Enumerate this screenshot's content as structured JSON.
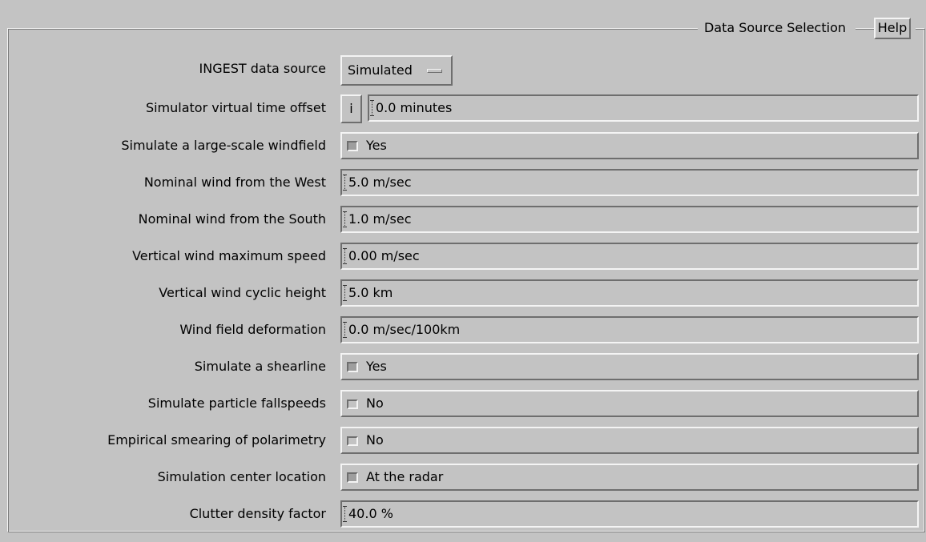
{
  "title": "Data Source Selection",
  "help_label": "Help",
  "ingest": {
    "label": "INGEST data source",
    "value": "Simulated"
  },
  "time_offset": {
    "label": "Simulator virtual time offset",
    "info_label": "i",
    "value": "0.0 minutes"
  },
  "rows": [
    {
      "label": "Simulate a large-scale windfield",
      "type": "toggle",
      "checked": true,
      "value": "Yes"
    },
    {
      "label": "Nominal wind from the West",
      "type": "field",
      "value": "5.0 m/sec"
    },
    {
      "label": "Nominal wind from the South",
      "type": "field",
      "value": "1.0 m/sec"
    },
    {
      "label": "Vertical wind maximum speed",
      "type": "field",
      "value": "0.00 m/sec"
    },
    {
      "label": "Vertical wind cyclic height",
      "type": "field",
      "value": "5.0 km"
    },
    {
      "label": "Wind field deformation",
      "type": "field",
      "value": "0.0 m/sec/100km"
    },
    {
      "label": "Simulate a shearline",
      "type": "toggle",
      "checked": true,
      "value": "Yes"
    },
    {
      "label": "Simulate particle fallspeeds",
      "type": "toggle",
      "checked": false,
      "value": "No"
    },
    {
      "label": "Empirical smearing of polarimetry",
      "type": "toggle",
      "checked": false,
      "value": "No"
    },
    {
      "label": "Simulation center location",
      "type": "toggle",
      "checked": true,
      "value": "At the radar"
    },
    {
      "label": "Clutter density factor",
      "type": "field",
      "value": "40.0 %"
    }
  ],
  "colors": {
    "background": "#c3c3c3",
    "highlight": "#f4f4f4",
    "shadow": "#6e6e6e",
    "check_on": "#9e9e9e"
  }
}
